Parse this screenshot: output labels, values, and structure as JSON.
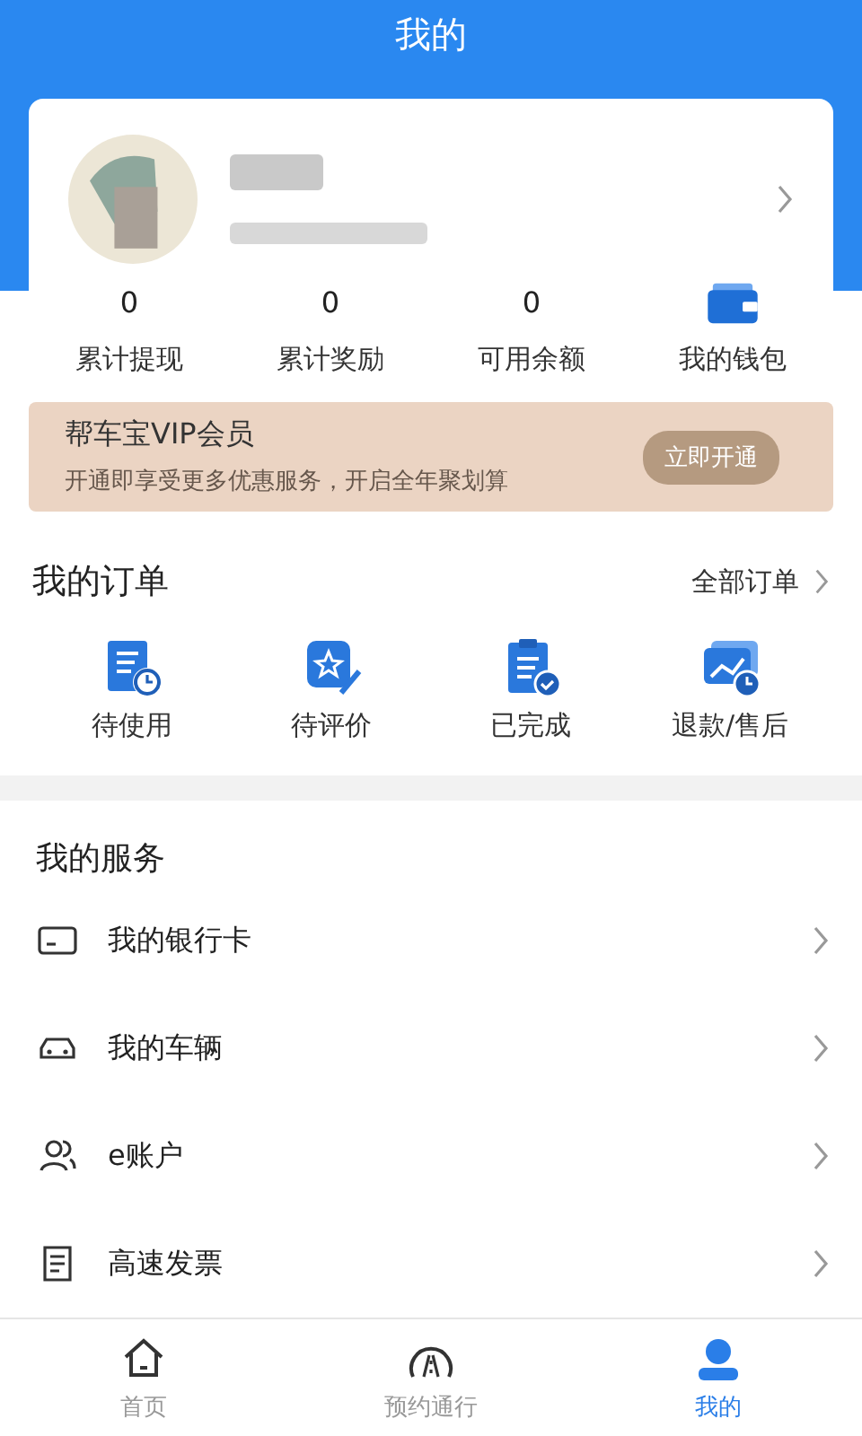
{
  "header": {
    "title": "我的"
  },
  "stats": [
    {
      "kind": "number",
      "value": "0",
      "label": "累计提现"
    },
    {
      "kind": "number",
      "value": "0",
      "label": "累计奖励"
    },
    {
      "kind": "number",
      "value": "0",
      "label": "可用余额"
    },
    {
      "kind": "wallet",
      "label": "我的钱包"
    }
  ],
  "vip": {
    "title": "帮车宝VIP会员",
    "subtitle": "开通即享受更多优惠服务，开启全年聚划算",
    "button": "立即开通"
  },
  "orders": {
    "title": "我的订单",
    "all_link": "全部订单",
    "items": [
      {
        "kind": "unused",
        "label": "待使用"
      },
      {
        "kind": "review",
        "label": "待评价"
      },
      {
        "kind": "done",
        "label": "已完成"
      },
      {
        "kind": "refund",
        "label": "退款/售后"
      }
    ]
  },
  "services": {
    "title": "我的服务",
    "items": [
      {
        "kind": "card",
        "label": "我的银行卡"
      },
      {
        "kind": "car",
        "label": "我的车辆"
      },
      {
        "kind": "account",
        "label": "e账户"
      },
      {
        "kind": "invoice",
        "label": "高速发票"
      }
    ]
  },
  "tabs": [
    {
      "kind": "home",
      "label": "首页",
      "selected": false
    },
    {
      "kind": "road",
      "label": "预约通行",
      "selected": false
    },
    {
      "kind": "me",
      "label": "我的",
      "selected": true
    }
  ]
}
